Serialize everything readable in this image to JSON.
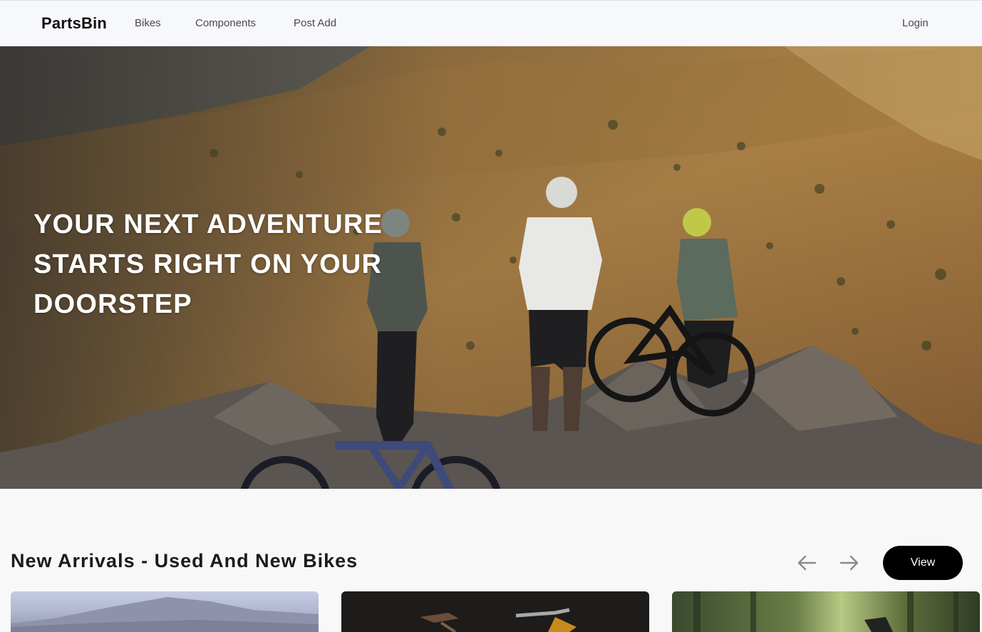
{
  "navbar": {
    "brand": "PartsBin",
    "links": [
      "Bikes",
      "Components",
      "Post Add"
    ],
    "login": "Login"
  },
  "hero": {
    "headline": "YOUR NEXT ADVENTURE STARTS RIGHT ON YOUR DOORSTEP",
    "image": "three mountain bikers with bikes on rocky desert ridge at sunset"
  },
  "new_arrivals": {
    "title": "New Arrivals - Used And New Bikes",
    "prev_icon": "arrow-left-icon",
    "next_icon": "arrow-right-icon",
    "view_label": "View",
    "cards": [
      {
        "image": "mountain landscape with sky"
      },
      {
        "image": "bikes on dark background"
      },
      {
        "image": "forest trail"
      }
    ]
  },
  "colors": {
    "navbar_bg": "#f7f8fb",
    "page_bg": "#f8f8f8",
    "button_bg": "#000000",
    "button_text": "#ffffff",
    "hero_text": "#ffffff"
  }
}
